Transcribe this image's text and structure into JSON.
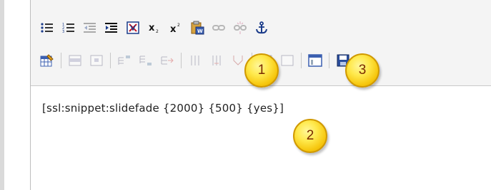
{
  "editor": {
    "content_text": "[ssl:snippet:slidefade {2000} {500} {yes}]"
  },
  "toolbar": {
    "row1": [
      {
        "icon": "unordered-list-icon",
        "enabled": true
      },
      {
        "icon": "ordered-list-icon",
        "enabled": true
      },
      {
        "icon": "outdent-icon",
        "enabled": false
      },
      {
        "icon": "indent-icon",
        "enabled": true
      },
      {
        "icon": "remove-format-icon",
        "enabled": true
      },
      {
        "icon": "subscript-icon",
        "enabled": true
      },
      {
        "icon": "superscript-icon",
        "enabled": true
      },
      {
        "icon": "paste-word-icon",
        "enabled": true
      },
      {
        "icon": "link-icon",
        "enabled": false
      },
      {
        "icon": "unlink-icon",
        "enabled": false
      },
      {
        "icon": "anchor-icon",
        "enabled": true
      }
    ],
    "row2": [
      {
        "icon": "insert-table-icon",
        "enabled": true
      },
      {
        "icon": "table-row-props-icon",
        "enabled": false
      },
      {
        "icon": "table-cell-props-icon",
        "enabled": false
      },
      {
        "icon": "insert-row-before-icon",
        "enabled": false
      },
      {
        "icon": "insert-row-after-icon",
        "enabled": false
      },
      {
        "icon": "delete-row-icon",
        "enabled": false
      },
      {
        "icon": "insert-col-icon",
        "enabled": false
      },
      {
        "icon": "delete-col-icon",
        "enabled": false
      },
      {
        "icon": "split-cells-icon",
        "enabled": false
      },
      {
        "icon": "merge-cells-icon",
        "enabled": false
      },
      {
        "icon": "template-icon",
        "enabled": true
      },
      {
        "icon": "save-icon",
        "enabled": true
      }
    ]
  },
  "callouts": {
    "one": "1",
    "two": "2",
    "three": "3"
  },
  "colors": {
    "callout_fill": "#ffe94d",
    "callout_border": "#d09900",
    "callout_text": "#7a2a00"
  }
}
